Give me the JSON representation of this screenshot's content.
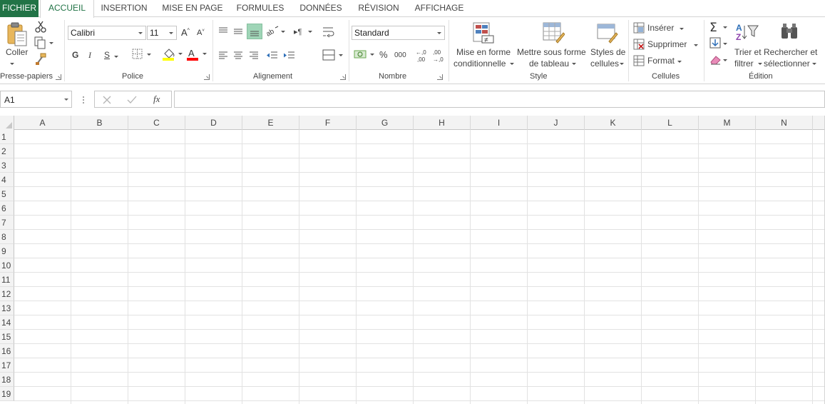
{
  "tabs": {
    "file": "FICHIER",
    "home": "ACCUEIL",
    "insert": "INSERTION",
    "page_layout": "MISE EN PAGE",
    "formulas": "FORMULES",
    "data": "DONNÉES",
    "review": "RÉVISION",
    "view": "AFFICHAGE"
  },
  "ribbon": {
    "clipboard": {
      "paste": "Coller",
      "label": "Presse-papiers"
    },
    "font": {
      "name": "Calibri",
      "size": "11",
      "bold": "G",
      "italic": "I",
      "underline": "S",
      "label": "Police"
    },
    "alignment": {
      "label": "Alignement"
    },
    "number": {
      "format": "Standard",
      "percent": "%",
      "thousands": "000",
      "dec_inc": "←,0\n,00",
      "dec_dec": ",00\n→,0",
      "label": "Nombre"
    },
    "styles": {
      "cond_format_1": "Mise en forme",
      "cond_format_2": "conditionnelle",
      "format_table_1": "Mettre sous forme",
      "format_table_2": "de tableau",
      "cell_styles_1": "Styles de",
      "cell_styles_2": "cellules",
      "label": "Style"
    },
    "cells": {
      "insert": "Insérer",
      "delete": "Supprimer",
      "format": "Format",
      "label": "Cellules"
    },
    "editing": {
      "sort_1": "Trier et",
      "sort_2": "filtrer",
      "find_1": "Rechercher et",
      "find_2": "sélectionner",
      "label": "Édition"
    }
  },
  "formula_bar": {
    "name_box": "A1",
    "fx": "fx",
    "value": ""
  },
  "grid": {
    "columns": [
      "A",
      "B",
      "C",
      "D",
      "E",
      "F",
      "G",
      "H",
      "I",
      "J",
      "K",
      "L",
      "M",
      "N"
    ],
    "rows": [
      "1",
      "2",
      "3",
      "4",
      "5",
      "6",
      "7",
      "8",
      "9",
      "10",
      "11",
      "12",
      "13",
      "14",
      "15",
      "16",
      "17",
      "18",
      "19"
    ]
  },
  "colors": {
    "brand_green": "#217346",
    "fill_yellow": "#ffff00",
    "font_red": "#ff0000",
    "align_active": "#9fd5b7"
  }
}
